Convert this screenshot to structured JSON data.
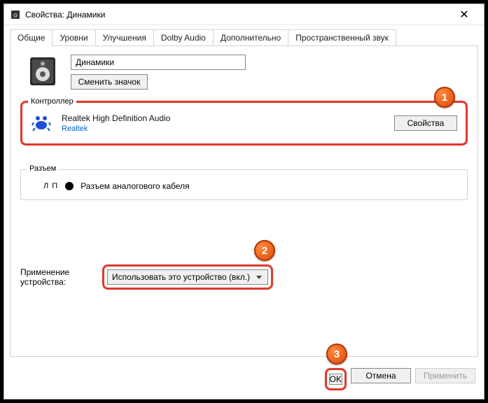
{
  "titlebar": {
    "title": "Свойства: Динамики"
  },
  "tabs": [
    "Общие",
    "Уровни",
    "Улучшения",
    "Dolby Audio",
    "Дополнительно",
    "Пространственный звук"
  ],
  "activeTab": 0,
  "deviceName": "Динамики",
  "changeIconLabel": "Сменить значок",
  "controller": {
    "groupLabel": "Контроллер",
    "name": "Realtek High Definition Audio",
    "vendorLink": "Realtek",
    "propsBtn": "Свойства"
  },
  "jack": {
    "groupLabel": "Разъем",
    "lp": "Л П",
    "desc": "Разъем аналогового кабеля"
  },
  "usage": {
    "label": "Применение устройства:",
    "selected": "Использовать это устройство (вкл.)"
  },
  "buttons": {
    "ok": "OK",
    "cancel": "Отмена",
    "apply": "Применить"
  },
  "badges": {
    "b1": "1",
    "b2": "2",
    "b3": "3"
  }
}
